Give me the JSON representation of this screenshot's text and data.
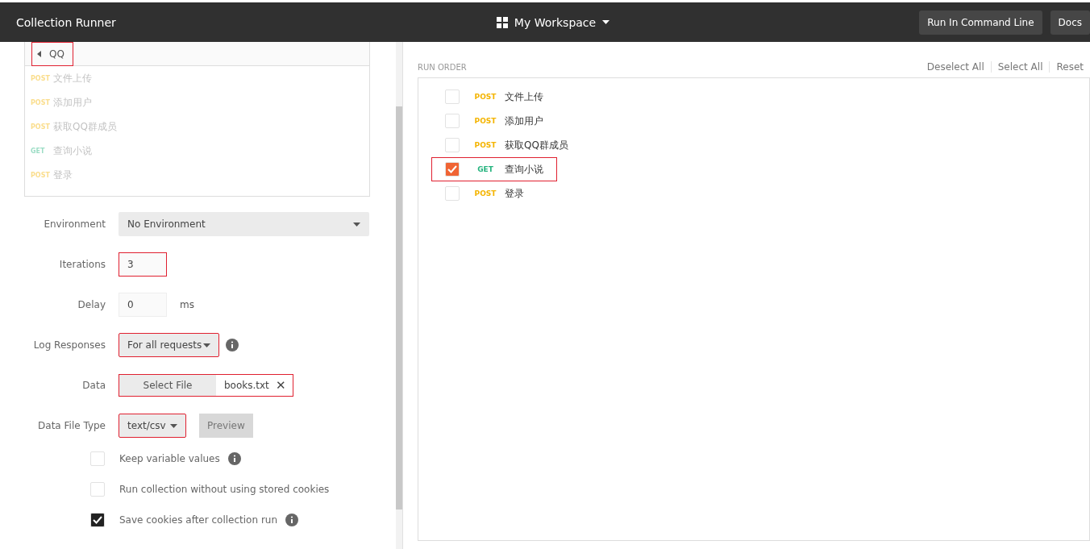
{
  "header": {
    "title": "Collection Runner",
    "workspace": "My Workspace",
    "buttons": [
      "Run In Command Line",
      "Docs"
    ]
  },
  "collection": {
    "name": "QQ",
    "expanded": false,
    "highlighted": true,
    "requests": [
      {
        "method": "POST",
        "name": "文件上传"
      },
      {
        "method": "POST",
        "name": "添加用户"
      },
      {
        "method": "POST",
        "name": "获取QQ群成员"
      },
      {
        "method": "GET",
        "name": "查询小说"
      },
      {
        "method": "POST",
        "name": "登录"
      }
    ]
  },
  "form": {
    "environment": {
      "label": "Environment",
      "value": "No Environment"
    },
    "iterations": {
      "label": "Iterations",
      "value": "3",
      "highlighted": true
    },
    "delay": {
      "label": "Delay",
      "value": "0",
      "unit": "ms"
    },
    "log_responses": {
      "label": "Log Responses",
      "value": "For all requests",
      "highlighted": true
    },
    "data": {
      "label": "Data",
      "button": "Select File",
      "file": "books.txt",
      "clear": "✕",
      "highlighted": true
    },
    "data_file_type": {
      "label": "Data File Type",
      "value": "text/csv",
      "highlighted": true,
      "preview": "Preview"
    }
  },
  "options": [
    {
      "label": "Keep variable values",
      "checked": false,
      "info": true
    },
    {
      "label": "Run collection without using stored cookies",
      "checked": false,
      "info": false
    },
    {
      "label": "Save cookies after collection run",
      "checked": true,
      "info": true
    }
  ],
  "run_order": {
    "title": "RUN ORDER",
    "actions": [
      "Deselect All",
      "Select All",
      "Reset"
    ],
    "items": [
      {
        "method": "POST",
        "name": "文件上传",
        "checked": false,
        "highlighted": false
      },
      {
        "method": "POST",
        "name": "添加用户",
        "checked": false,
        "highlighted": false
      },
      {
        "method": "POST",
        "name": "获取QQ群成员",
        "checked": false,
        "highlighted": false
      },
      {
        "method": "GET",
        "name": "查询小说",
        "checked": true,
        "highlighted": true
      },
      {
        "method": "POST",
        "name": "登录",
        "checked": false,
        "highlighted": false
      }
    ]
  }
}
